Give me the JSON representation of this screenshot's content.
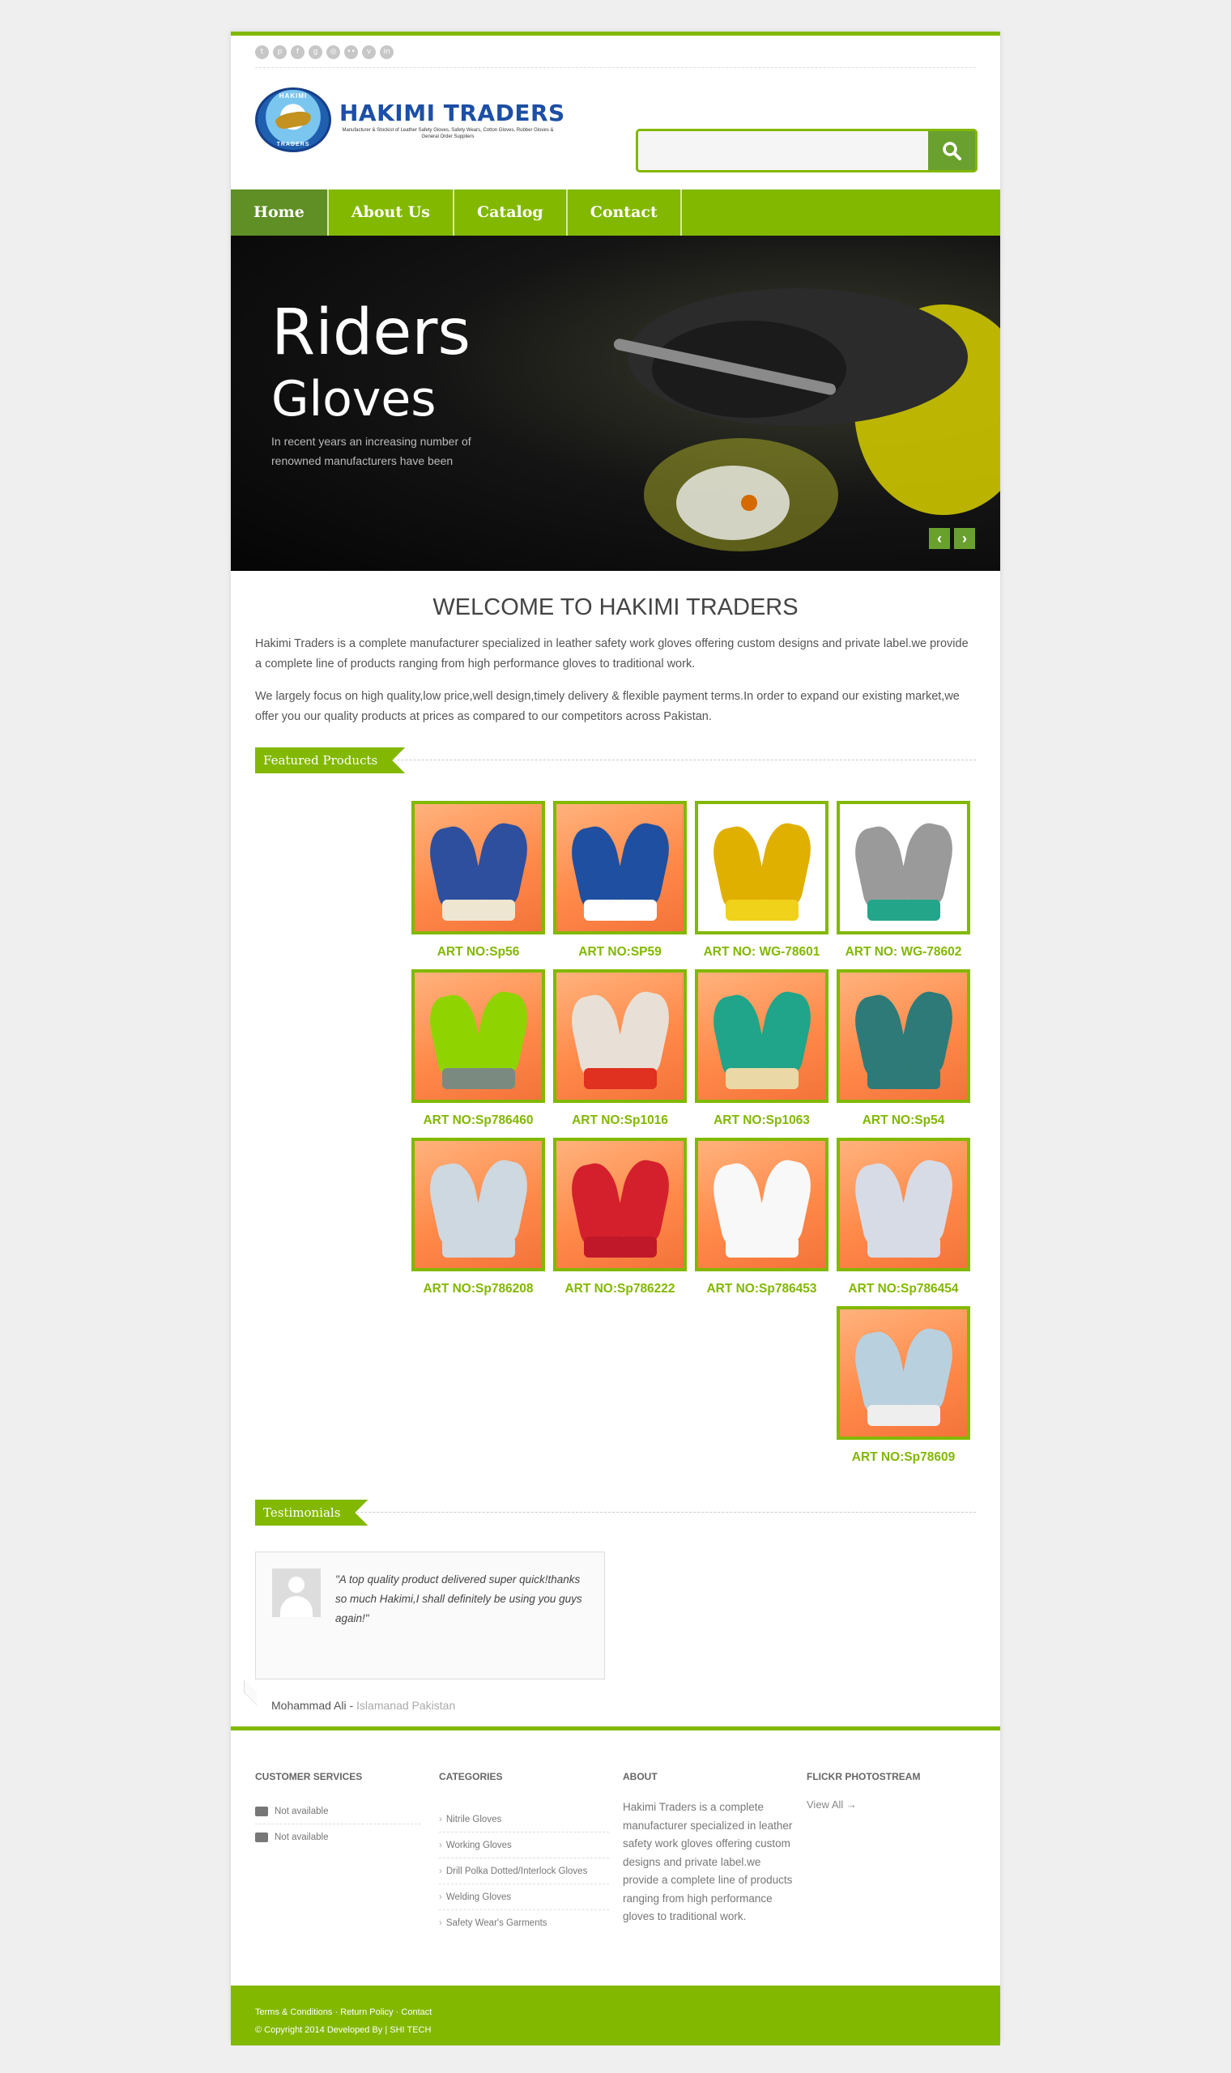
{
  "social_icons": [
    "twitter-icon",
    "pinterest-icon",
    "facebook-icon",
    "google-plus-icon",
    "instagram-icon",
    "flickr-icon",
    "vimeo-icon",
    "linkedin-icon"
  ],
  "logo": {
    "badge_top": "HAKIMI",
    "badge_bottom": "TRADERS",
    "name": "HAKIMI TRADERS",
    "tagline": "Manufacturer & Stockist of Leather Safety Gloves, Safety Wears, Cotton Gloves, Rubber Gloves & General Order Suppliers"
  },
  "search": {
    "value": "",
    "placeholder": ""
  },
  "nav": [
    {
      "label": "Home",
      "active": true
    },
    {
      "label": "About Us",
      "active": false
    },
    {
      "label": "Catalog",
      "active": false
    },
    {
      "label": "Contact",
      "active": false
    }
  ],
  "hero": {
    "title_line1": "Riders",
    "title_line2": "Gloves",
    "subtitle": "In recent years an increasing number of renowned manufacturers have been"
  },
  "welcome": {
    "title": "WELCOME TO HAKIMI TRADERS",
    "paragraph1": "Hakimi Traders is a complete manufacturer specialized in leather safety work gloves offering custom designs and private label.we provide a complete line of products ranging from high performance gloves to traditional work.",
    "paragraph2": "We largely focus on high quality,low price,well design,timely delivery & flexible payment terms.In order to expand our existing market,we offer you our quality products at prices as compared to our competitors across Pakistan."
  },
  "featured": {
    "heading": "Featured Products",
    "products": [
      {
        "label": "ART NO:Sp56",
        "color": "#2d4f9e",
        "cuff": "#efe6d2"
      },
      {
        "label": "ART NO:SP59",
        "color": "#1f4fa0",
        "cuff": "#ffffff"
      },
      {
        "label": "ART NO: WG-78601",
        "color": "#e0b000",
        "cuff": "#f0d21a"
      },
      {
        "label": "ART NO: WG-78602",
        "color": "#9a9a9a",
        "cuff": "#23a58a"
      },
      {
        "label": "ART NO:Sp786460",
        "color": "#8fd400",
        "cuff": "#7a8a80"
      },
      {
        "label": "ART NO:Sp1016",
        "color": "#e8e0d6",
        "cuff": "#e03020"
      },
      {
        "label": "ART NO:Sp1063",
        "color": "#20a48a",
        "cuff": "#ead9a6"
      },
      {
        "label": "ART NO:Sp54",
        "color": "#2e7a78",
        "cuff": "#2e7a78"
      },
      {
        "label": "ART NO:Sp786208",
        "color": "#cdd8e0",
        "cuff": "#cdd8e0"
      },
      {
        "label": "ART NO:Sp786222",
        "color": "#d4202c",
        "cuff": "#c01828"
      },
      {
        "label": "ART NO:Sp786453",
        "color": "#f8f8f8",
        "cuff": "#f8f8f8"
      },
      {
        "label": "ART NO:Sp786454",
        "color": "#d7dbe6",
        "cuff": "#d7dbe6"
      },
      {
        "label": "ART NO:Sp78609",
        "color": "#b9d0df",
        "cuff": "#eeeeee"
      }
    ]
  },
  "testimonials": {
    "heading": "Testimonials",
    "quote": "\"A top quality product delivered super quick!thanks so much Hakimi,I shall definitely be using you guys again!\"",
    "author": "Mohammad Ali",
    "location": "Islamanad Pakistan"
  },
  "footer": {
    "customer_services": {
      "heading": "CUSTOMER SERVICES",
      "phone": "Not available",
      "email": "Not available"
    },
    "categories": {
      "heading": "CATEGORIES",
      "items": [
        "Nitrile Gloves",
        "Working Gloves",
        "Drill Polka Dotted/Interlock Gloves",
        "Welding Gloves",
        "Safety Wear's Garments"
      ]
    },
    "about": {
      "heading": "ABOUT",
      "text": "Hakimi Traders is a complete manufacturer specialized in leather safety work gloves offering custom designs and private label.we provide a complete line of products ranging from high performance gloves to traditional work."
    },
    "flickr": {
      "heading": "FLICKR PHOTOSTREAM",
      "link": "View All →"
    }
  },
  "bottom_bar": {
    "links": [
      "Terms & Conditions",
      "Return Policy",
      "Contact"
    ],
    "copyright": "© Copyright 2014   Developed By | SHI TECH"
  },
  "colors": {
    "accent": "#82b800",
    "accent_dark": "#5f8f25",
    "brand_blue": "#1c4fa5"
  }
}
